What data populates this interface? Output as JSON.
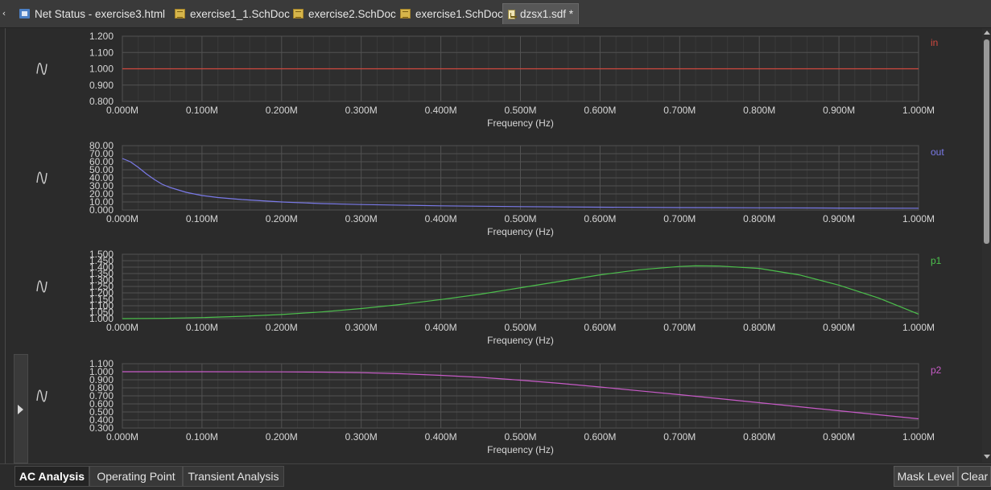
{
  "tabs": [
    {
      "label": "Net Status - exercise3.html",
      "icon": "html-file-icon",
      "active": false
    },
    {
      "label": "exercise1_1.SchDoc",
      "icon": "schematic-file-icon",
      "active": false
    },
    {
      "label": "exercise2.SchDoc",
      "icon": "schematic-file-icon",
      "active": false
    },
    {
      "label": "exercise1.SchDoc",
      "icon": "schematic-file-icon",
      "active": false
    },
    {
      "label": "dzsx1.sdf *",
      "icon": "simulation-file-icon",
      "active": true
    }
  ],
  "plot_icon": "sine-wave-icon",
  "chart_data": [
    {
      "type": "line",
      "series": [
        {
          "name": "in",
          "color": "#d0493f",
          "x": [
            0,
            0.1,
            0.2,
            0.3,
            0.4,
            0.5,
            0.6,
            0.7,
            0.8,
            0.9,
            1.0
          ],
          "values": [
            1.0,
            1.0,
            1.0,
            1.0,
            1.0,
            1.0,
            1.0,
            1.0,
            1.0,
            1.0,
            1.0
          ]
        }
      ],
      "xlabel": "Frequency (Hz)",
      "xticks": [
        "0.000M",
        "0.100M",
        "0.200M",
        "0.300M",
        "0.400M",
        "0.500M",
        "0.600M",
        "0.700M",
        "0.800M",
        "0.900M",
        "1.000M"
      ],
      "yticks": [
        "1.200",
        "1.100",
        "1.000",
        "0.900",
        "0.800"
      ],
      "ylim": [
        0.8,
        1.2
      ],
      "grid": true
    },
    {
      "type": "line",
      "series": [
        {
          "name": "out",
          "color": "#7a7ae8",
          "x": [
            0,
            0.01,
            0.02,
            0.03,
            0.04,
            0.05,
            0.06,
            0.08,
            0.1,
            0.12,
            0.15,
            0.2,
            0.25,
            0.3,
            0.4,
            0.5,
            0.6,
            0.7,
            0.8,
            0.9,
            1.0
          ],
          "values": [
            64,
            60,
            53,
            45,
            38,
            32,
            28,
            22,
            18,
            15.5,
            13,
            10,
            8,
            6.8,
            5.2,
            4.2,
            3.5,
            3.0,
            2.7,
            2.4,
            2.2
          ]
        }
      ],
      "xlabel": "Frequency (Hz)",
      "xticks": [
        "0.000M",
        "0.100M",
        "0.200M",
        "0.300M",
        "0.400M",
        "0.500M",
        "0.600M",
        "0.700M",
        "0.800M",
        "0.900M",
        "1.000M"
      ],
      "yticks": [
        "80.00",
        "70.00",
        "60.00",
        "50.00",
        "40.00",
        "30.00",
        "20.00",
        "10.00",
        "0.000"
      ],
      "ylim": [
        0,
        80
      ],
      "grid": true
    },
    {
      "type": "line",
      "series": [
        {
          "name": "p1",
          "color": "#4cc04c",
          "x": [
            0,
            0.05,
            0.1,
            0.15,
            0.2,
            0.25,
            0.3,
            0.35,
            0.4,
            0.45,
            0.5,
            0.55,
            0.6,
            0.65,
            0.7,
            0.72,
            0.75,
            0.8,
            0.85,
            0.9,
            0.95,
            1.0
          ],
          "values": [
            1.0,
            1.002,
            1.008,
            1.018,
            1.032,
            1.052,
            1.078,
            1.11,
            1.148,
            1.19,
            1.24,
            1.29,
            1.34,
            1.38,
            1.405,
            1.41,
            1.408,
            1.39,
            1.34,
            1.26,
            1.16,
            1.035
          ]
        }
      ],
      "xlabel": "Frequency (Hz)",
      "xticks": [
        "0.000M",
        "0.100M",
        "0.200M",
        "0.300M",
        "0.400M",
        "0.500M",
        "0.600M",
        "0.700M",
        "0.800M",
        "0.900M",
        "1.000M"
      ],
      "yticks": [
        "1.500",
        "1.450",
        "1.400",
        "1.350",
        "1.300",
        "1.250",
        "1.200",
        "1.150",
        "1.100",
        "1.050",
        "1.000"
      ],
      "ylim": [
        1.0,
        1.5
      ],
      "grid": true
    },
    {
      "type": "line",
      "series": [
        {
          "name": "p2",
          "color": "#c75bc7",
          "x": [
            0,
            0.1,
            0.2,
            0.25,
            0.3,
            0.35,
            0.4,
            0.45,
            0.5,
            0.55,
            0.6,
            0.65,
            0.7,
            0.75,
            0.8,
            0.85,
            0.9,
            0.95,
            1.0
          ],
          "values": [
            1.0,
            1.0,
            0.998,
            0.995,
            0.988,
            0.975,
            0.955,
            0.93,
            0.895,
            0.855,
            0.81,
            0.762,
            0.715,
            0.665,
            0.615,
            0.565,
            0.515,
            0.465,
            0.415
          ]
        }
      ],
      "xlabel": "Frequency (Hz)",
      "xticks": [
        "0.000M",
        "0.100M",
        "0.200M",
        "0.300M",
        "0.400M",
        "0.500M",
        "0.600M",
        "0.700M",
        "0.800M",
        "0.900M",
        "1.000M"
      ],
      "yticks": [
        "1.100",
        "1.000",
        "0.900",
        "0.800",
        "0.700",
        "0.600",
        "0.500",
        "0.400",
        "0.300"
      ],
      "ylim": [
        0.3,
        1.1
      ],
      "grid": true
    }
  ],
  "bottom_tabs": [
    {
      "label": "AC Analysis",
      "active": true
    },
    {
      "label": "Operating Point",
      "active": false
    },
    {
      "label": "Transient Analysis",
      "active": false
    }
  ],
  "buttons": {
    "mask_level": "Mask Level",
    "clear": "Clear"
  }
}
